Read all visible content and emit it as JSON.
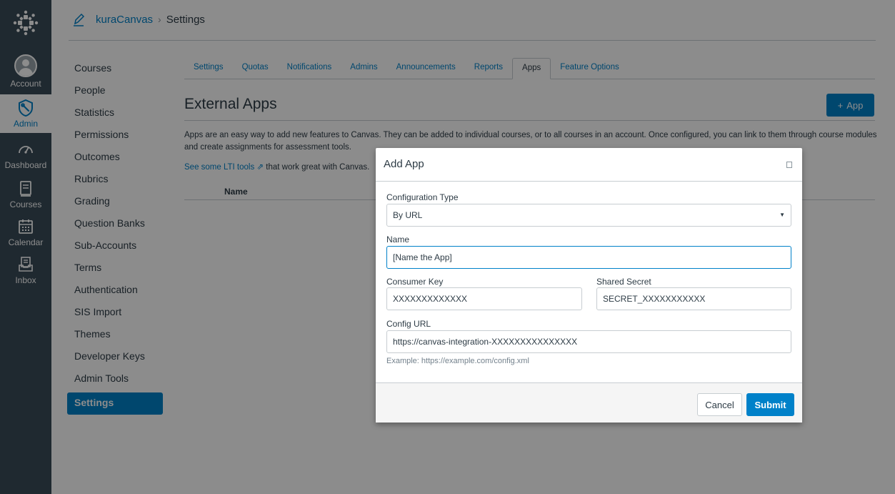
{
  "global_nav": {
    "account": "Account",
    "admin": "Admin",
    "dashboard": "Dashboard",
    "courses": "Courses",
    "calendar": "Calendar",
    "inbox": "Inbox"
  },
  "breadcrumb": {
    "account": "kuraCanvas",
    "separator": "›",
    "current": "Settings"
  },
  "sidebar": {
    "items": [
      {
        "label": "Courses"
      },
      {
        "label": "People"
      },
      {
        "label": "Statistics"
      },
      {
        "label": "Permissions"
      },
      {
        "label": "Outcomes"
      },
      {
        "label": "Rubrics"
      },
      {
        "label": "Grading"
      },
      {
        "label": "Question Banks"
      },
      {
        "label": "Sub-Accounts"
      },
      {
        "label": "Terms"
      },
      {
        "label": "Authentication"
      },
      {
        "label": "SIS Import"
      },
      {
        "label": "Themes"
      },
      {
        "label": "Developer Keys"
      },
      {
        "label": "Admin Tools"
      },
      {
        "label": "Settings"
      }
    ]
  },
  "tabs": [
    {
      "label": "Settings"
    },
    {
      "label": "Quotas"
    },
    {
      "label": "Notifications"
    },
    {
      "label": "Admins"
    },
    {
      "label": "Announcements"
    },
    {
      "label": "Reports"
    },
    {
      "label": "Apps"
    },
    {
      "label": "Feature Options"
    }
  ],
  "main": {
    "title": "External Apps",
    "add_app_label": "App",
    "add_app_icon": "+",
    "description": "Apps are an easy way to add new features to Canvas. They can be added to individual courses, or to all courses in an account. Once configured, you can link to them through course modules and create assignments for assessment tools.",
    "lti_link": "See some LTI tools",
    "lti_link_icon": "⇗",
    "lti_suffix": " that work great with Canvas.",
    "table_header_name": "Name"
  },
  "modal": {
    "title": "Add App",
    "config_type_label": "Configuration Type",
    "config_type_value": "By URL",
    "name_label": "Name",
    "name_value": "[Name the App]",
    "consumer_key_label": "Consumer Key",
    "consumer_key_value": "XXXXXXXXXXXXX",
    "shared_secret_label": "Shared Secret",
    "shared_secret_value": "SECRET_XXXXXXXXXXX",
    "config_url_label": "Config URL",
    "config_url_value": "https://canvas-integration-XXXXXXXXXXXXXXX",
    "config_url_hint": "Example: https://example.com/config.xml",
    "cancel_label": "Cancel",
    "submit_label": "Submit"
  }
}
